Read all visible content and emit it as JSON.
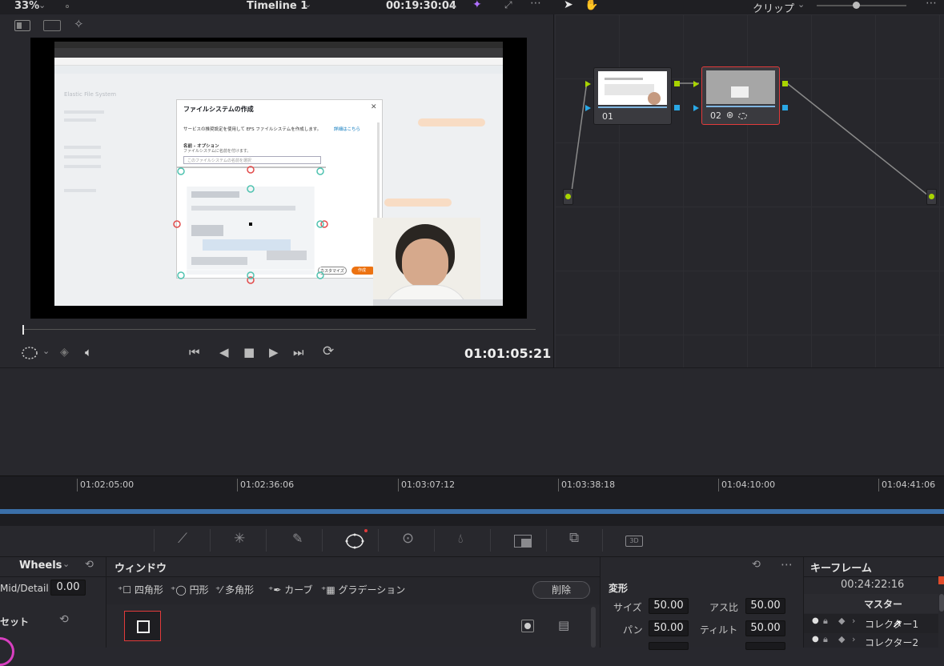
{
  "viewer": {
    "zoom": "33%",
    "timeline_name": "Timeline 1",
    "source_timecode": "00:19:30:04",
    "current_timecode": "01:01:05:21"
  },
  "node_header": {
    "mode_label": "クリップ"
  },
  "nodes": [
    {
      "label": "01"
    },
    {
      "label": "02"
    }
  ],
  "video_content": {
    "dialog_title": "ファイルシステムの作成",
    "dialog_desc": "サービスの推奨設定を使用して EFS ファイルシステムを作成します。",
    "dialog_link": "詳細はこちら",
    "name_label": "名前 - オプション",
    "name_hint": "ファイルシステムに名前を付けます。",
    "name_placeholder": "このファイルシステムの名前を選択",
    "customize_btn": "カスタマイズ",
    "create_btn": "作成",
    "sidebar_title": "Elastic File System"
  },
  "ruler": {
    "ticks": [
      "01:02:05:00",
      "01:02:36:06",
      "01:03:07:12",
      "01:03:38:18",
      "01:04:10:00",
      "01:04:41:06"
    ]
  },
  "tools": [
    "curves-icon",
    "warper-icon",
    "qualifier-icon",
    "window-icon",
    "tracker-icon",
    "blur-icon",
    "key-icon",
    "sizing-icon",
    "3d-icon"
  ],
  "wheels_panel": {
    "title": "Wheels",
    "mid_detail_label": "Mid/Detail",
    "mid_detail_value": "0.00",
    "preset_label": "セット"
  },
  "window_panel": {
    "title": "ウィンドウ",
    "shapes": [
      "四角形",
      "円形",
      "多角形",
      "カーブ",
      "グラデーション"
    ],
    "delete_label": "削除"
  },
  "transform_panel": {
    "title": "変形",
    "size_label": "サイズ",
    "size_value": "50.00",
    "aspect_label": "アス比",
    "aspect_value": "50.00",
    "pan_label": "パン",
    "pan_value": "50.00",
    "tilt_label": "ティルト",
    "tilt_value": "50.00"
  },
  "keyframe_panel": {
    "title": "キーフレーム",
    "timecode": "00:24:22:16",
    "master_label": "マスター",
    "rows": [
      "コレクター1",
      "コレクター2"
    ]
  },
  "colors": {
    "accent_blue": "#3b6fa8",
    "selected_red": "#e23b3b",
    "port_green": "#a8d400",
    "port_blue": "#2aa8e6"
  }
}
